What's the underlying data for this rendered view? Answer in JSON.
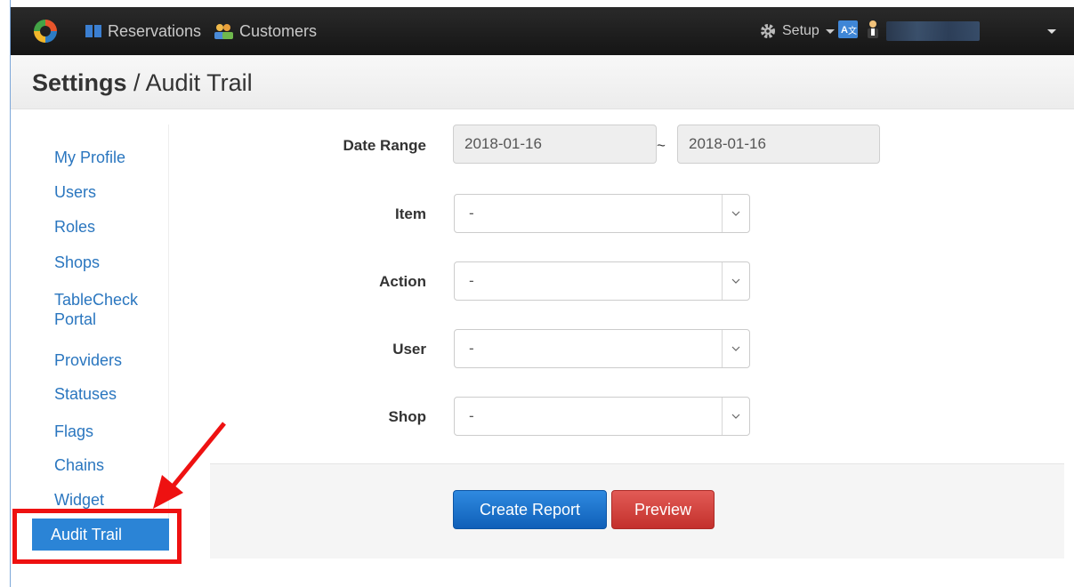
{
  "nav": {
    "reservations": "Reservations",
    "customers": "Customers",
    "setup": "Setup"
  },
  "header": {
    "section": "Settings",
    "separator": " / ",
    "page": "Audit Trail"
  },
  "sidebar": {
    "items": [
      {
        "label": "My Profile"
      },
      {
        "label": "Users"
      },
      {
        "label": "Roles"
      },
      {
        "label": "Shops"
      },
      {
        "label": "TableCheck"
      },
      {
        "label": "Portal"
      },
      {
        "label": "Providers"
      },
      {
        "label": "Statuses"
      },
      {
        "label": "Flags"
      },
      {
        "label": "Chains"
      },
      {
        "label": "Widget"
      },
      {
        "label": "Audit Trail"
      }
    ]
  },
  "form": {
    "date_range_label": "Date Range",
    "date_from": "2018-01-16",
    "date_sep": "~",
    "date_to": "2018-01-16",
    "item_label": "Item",
    "item_value": "-",
    "action_label": "Action",
    "action_value": "-",
    "user_label": "User",
    "user_value": "-",
    "shop_label": "Shop",
    "shop_value": "-"
  },
  "buttons": {
    "create_report": "Create Report",
    "preview": "Preview"
  },
  "colors": {
    "navbar": "#1e1e1e",
    "link": "#2a76bf",
    "active": "#2b84d6",
    "primary": "#1a6fd0",
    "danger": "#d0403b",
    "annotation": "#ee1111"
  }
}
